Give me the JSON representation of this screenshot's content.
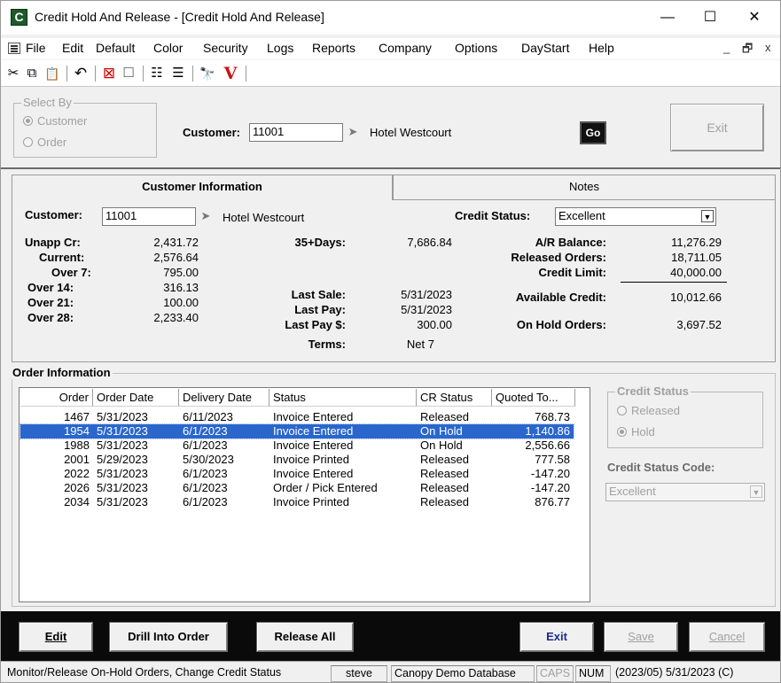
{
  "window": {
    "title": "Credit Hold And Release - [Credit Hold And Release]",
    "app_icon_letter": "C",
    "minimize": "—",
    "maximize": "☐",
    "close": "✕"
  },
  "menu": {
    "items": [
      "File",
      "Edit",
      "Default",
      "Color",
      "Security",
      "Logs",
      "Reports",
      "Company",
      "Options",
      "DayStart",
      "Help"
    ],
    "mdi_min": "_",
    "mdi_restore": "🗗",
    "mdi_close": "x"
  },
  "toolbar": {
    "icons": [
      "cut-icon",
      "copy-icon",
      "paste-icon",
      "undo-icon",
      "delete-icon",
      "blank-icon",
      "list-bullets-icon",
      "list-numbered-icon",
      "find-icon",
      "v-logo-icon"
    ],
    "glyphs": {
      "cut": "✂",
      "copy": "⧉",
      "paste": "📋",
      "undo": "↶",
      "delete": "⊠",
      "blank": "☐",
      "list1": "☷",
      "list2": "☰",
      "find": "🔭",
      "v": "V"
    }
  },
  "select_by": {
    "legend": "Select By",
    "option_customer": "Customer",
    "option_order": "Order",
    "customer_label": "Customer:",
    "customer_value": "11001",
    "customer_name": "Hotel Westcourt",
    "go_label": "Go",
    "exit_label": "Exit"
  },
  "tabs": {
    "customer_info": "Customer Information",
    "notes": "Notes"
  },
  "customer_info": {
    "customer_label": "Customer:",
    "customer_value": "11001",
    "customer_name": "Hotel Westcourt",
    "credit_status_label": "Credit Status:",
    "credit_status_value": "Excellent",
    "aging": [
      {
        "label": "Unapp Cr:",
        "value": "2,431.72"
      },
      {
        "label": "Current:",
        "value": "2,576.64"
      },
      {
        "label": "Over 7:",
        "value": "795.00"
      },
      {
        "label": "Over 14:",
        "value": "316.13"
      },
      {
        "label": "Over 21:",
        "value": "100.00"
      },
      {
        "label": "Over 28:",
        "value": "2,233.40"
      }
    ],
    "days35_label": "35+Days:",
    "days35_value": "7,686.84",
    "last_sale_label": "Last Sale:",
    "last_sale_value": "5/31/2023",
    "last_pay_label": "Last Pay:",
    "last_pay_value": "5/31/2023",
    "last_pay_amt_label": "Last Pay $:",
    "last_pay_amt_value": "300.00",
    "terms_label": "Terms:",
    "terms_value": "Net 7",
    "ar_balance_label": "A/R Balance:",
    "ar_balance_value": "11,276.29",
    "released_orders_label": "Released Orders:",
    "released_orders_value": "18,711.05",
    "credit_limit_label": "Credit Limit:",
    "credit_limit_value": "40,000.00",
    "available_credit_label": "Available Credit:",
    "available_credit_value": "10,012.66",
    "on_hold_orders_label": "On Hold Orders:",
    "on_hold_orders_value": "3,697.52"
  },
  "orders": {
    "section_label": "Order Information",
    "columns": [
      "Order",
      "Order Date",
      "Delivery Date",
      "Status",
      "CR Status",
      "Quoted To..."
    ],
    "rows": [
      {
        "order": "1467",
        "order_date": "5/31/2023",
        "delivery_date": "6/11/2023",
        "status": "Invoice Entered",
        "cr_status": "Released",
        "quoted": "768.73"
      },
      {
        "order": "1954",
        "order_date": "5/31/2023",
        "delivery_date": "6/1/2023",
        "status": "Invoice Entered",
        "cr_status": "On Hold",
        "quoted": "1,140.86"
      },
      {
        "order": "1988",
        "order_date": "5/31/2023",
        "delivery_date": "6/1/2023",
        "status": "Invoice Entered",
        "cr_status": "On Hold",
        "quoted": "2,556.66"
      },
      {
        "order": "2001",
        "order_date": "5/29/2023",
        "delivery_date": "5/30/2023",
        "status": "Invoice Printed",
        "cr_status": "Released",
        "quoted": "777.58"
      },
      {
        "order": "2022",
        "order_date": "5/31/2023",
        "delivery_date": "6/1/2023",
        "status": "Invoice Entered",
        "cr_status": "Released",
        "quoted": "-147.20"
      },
      {
        "order": "2026",
        "order_date": "5/31/2023",
        "delivery_date": "6/1/2023",
        "status": "Order / Pick Entered",
        "cr_status": "Released",
        "quoted": "-147.20"
      },
      {
        "order": "2034",
        "order_date": "5/31/2023",
        "delivery_date": "6/1/2023",
        "status": "Invoice Printed",
        "cr_status": "Released",
        "quoted": "876.77"
      }
    ],
    "selected_order": "1954"
  },
  "credit_status_panel": {
    "legend": "Credit Status",
    "option_released": "Released",
    "option_hold": "Hold",
    "code_label": "Credit Status Code:",
    "code_value": "Excellent"
  },
  "bottom_buttons": {
    "edit": "Edit",
    "drill": "Drill Into Order",
    "release_all": "Release All",
    "exit": "Exit",
    "save": "Save",
    "cancel": "Cancel"
  },
  "statusbar": {
    "message": "Monitor/Release On-Hold Orders, Change Credit Status",
    "user": "steve",
    "database": "Canopy Demo Database",
    "caps": "CAPS",
    "num": "NUM",
    "period_date": "(2023/05) 5/31/2023 (C)"
  },
  "colors": {
    "selection": "#2a66cc",
    "bottom_bar": "#0a0a0a",
    "app_icon": "#1e5a2a",
    "drilldown_v": "#cc1111"
  }
}
